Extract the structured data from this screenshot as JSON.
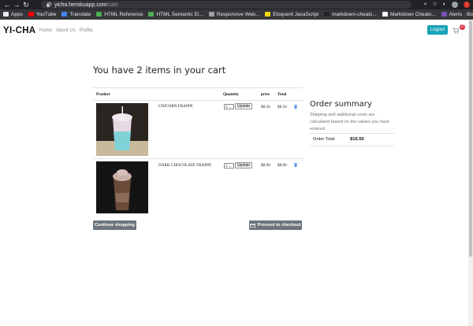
{
  "browser": {
    "url_host": "yicha.herokuapp.com",
    "url_path": "/cart",
    "back": "←",
    "forward": "→",
    "reload": "↻",
    "bookmarks": [
      {
        "label": "Apps",
        "color": "#e8eaed"
      },
      {
        "label": "YouTube",
        "color": "#ff0000"
      },
      {
        "label": "Translate",
        "color": "#4285f4"
      },
      {
        "label": "HTML Reference",
        "color": "#4caf50"
      },
      {
        "label": "HTML Semantic El...",
        "color": "#4caf50"
      },
      {
        "label": "Responsive Web...",
        "color": "#9e9e9e"
      },
      {
        "label": "Eloquent JavaScript",
        "color": "#f5d90a"
      },
      {
        "label": "markdown-cheats...",
        "color": "#202124"
      },
      {
        "label": "Markdown Cheats...",
        "color": "#ffffff"
      },
      {
        "label": "Alerts · Bootstrap...",
        "color": "#7952b3"
      }
    ]
  },
  "site": {
    "brand": "YI-CHA",
    "nav": [
      "Home",
      "About Us",
      "Profile"
    ],
    "logout_label": "Logout",
    "cart_count": "2",
    "accent": "#17a2b8"
  },
  "cart": {
    "heading": "You have 2 items in your cart",
    "columns": [
      "Product",
      "Quantity",
      "price",
      "Total"
    ],
    "items": [
      {
        "name": "UNICORN FRAPPE",
        "qty": "1",
        "update_label": "Update",
        "price": "$8.50",
        "total": "$8.50",
        "drink_color": "#7fd3d6"
      },
      {
        "name": "DARK CHOCOLATE FRAPPE",
        "qty": "1",
        "update_label": "Update",
        "price": "$8.00",
        "total": "$8.00",
        "drink_color": "#6b4a3a"
      }
    ],
    "continue_label": "Continue shopping",
    "checkout_label": "Proceed to checkout"
  },
  "summary": {
    "title": "Order summary",
    "description": "Shipping and additional costs are calculated based on the values you have entered.",
    "total_label": "Order Total",
    "total_value": "$16.50"
  }
}
